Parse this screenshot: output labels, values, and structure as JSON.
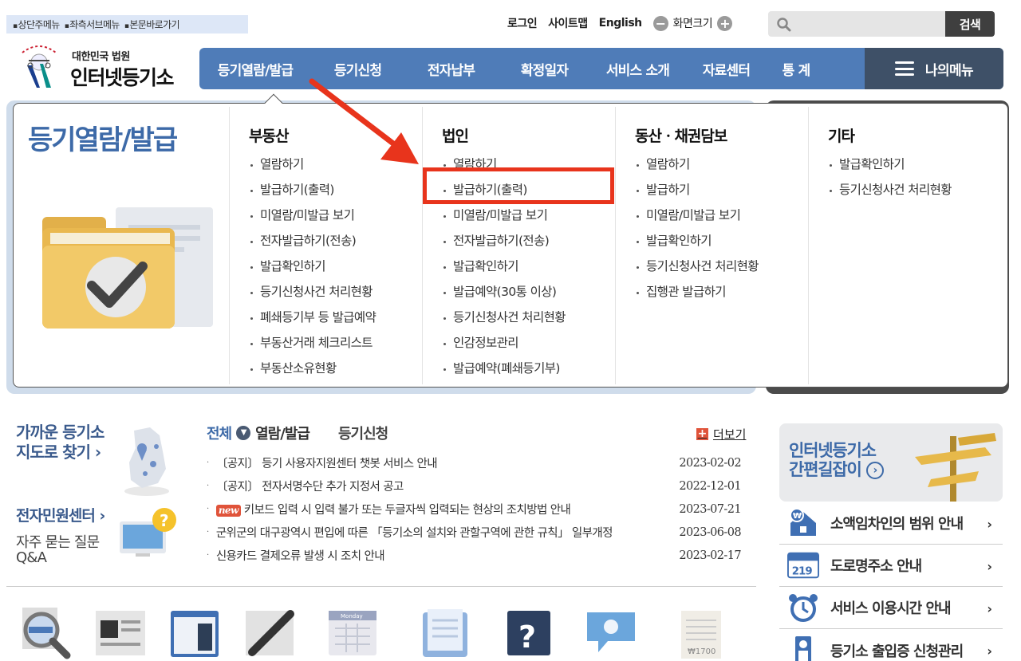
{
  "skip_links": [
    "상단주메뉴",
    "좌측서브메뉴",
    "본문바로가기"
  ],
  "top_links": {
    "login": "로그인",
    "sitemap": "사이트맵",
    "english": "English",
    "zoom": "화면크기"
  },
  "search": {
    "placeholder": "",
    "button": "검색"
  },
  "logo": {
    "sub": "대한민국 법원",
    "main": "인터넷등기소"
  },
  "gnb": {
    "items": [
      "등기열람/발급",
      "등기신청",
      "전자납부",
      "확정일자",
      "서비스 소개",
      "자료센터",
      "통 계"
    ],
    "my_menu": "나의메뉴"
  },
  "dropdown": {
    "title": "등기열람/발급",
    "columns": [
      {
        "heading": "부동산",
        "items": [
          "열람하기",
          "발급하기(출력)",
          "미열람/미발급 보기",
          "전자발급하기(전송)",
          "발급확인하기",
          "등기신청사건 처리현황",
          "폐쇄등기부 등 발급예약",
          "부동산거래 체크리스트",
          "부동산소유현황"
        ]
      },
      {
        "heading": "법인",
        "items": [
          "열람하기",
          "발급하기(출력)",
          "미열람/미발급 보기",
          "전자발급하기(전송)",
          "발급확인하기",
          "발급예약(30통 이상)",
          "등기신청사건 처리현황",
          "인감정보관리",
          "발급예약(폐쇄등기부)"
        ]
      },
      {
        "heading": "동산ㆍ채권담보",
        "items": [
          "열람하기",
          "발급하기",
          "미열람/미발급 보기",
          "발급확인하기",
          "등기신청사건 처리현황",
          "집행관 발급하기"
        ]
      },
      {
        "heading": "기타",
        "items": [
          "발급확인하기",
          "등기신청사건 처리현황"
        ]
      }
    ]
  },
  "left": {
    "nearby_line1": "가까운 등기소",
    "nearby_line2": "지도로 찾기 ›",
    "civil_title": "전자민원센터 ›",
    "civil_sub1": "자주 묻는 질문",
    "civil_sub2": "Q&A"
  },
  "notice_tabs": {
    "all": "전체",
    "view": "열람/발급",
    "apply": "등기신청"
  },
  "more": "더보기",
  "notices": [
    {
      "badge": "",
      "text": "〔공지〕 등기 사용자지원센터 챗봇 서비스 안내",
      "date": "2023-02-02"
    },
    {
      "badge": "",
      "text": "〔공지〕 전자서명수단 추가 지정서 공고",
      "date": "2022-12-01"
    },
    {
      "badge": "new",
      "text": "키보드 입력 시 입력 불가 또는 두글자씩 입력되는 현상의 조치방법 안내",
      "date": "2023-07-21"
    },
    {
      "badge": "",
      "text": "군위군의 대구광역시 편입에 따른 「등기소의 설치와 관할구역에 관한 규칙」 일부개정",
      "date": "2023-06-08"
    },
    {
      "badge": "",
      "text": "신용카드 결제오류 발생 시 조치 안내",
      "date": "2023-02-17"
    }
  ],
  "guide": {
    "line1": "인터넷등기소",
    "line2": "간편길잡이"
  },
  "right_links": [
    "소액임차인의 범위 안내",
    "도로명주소 안내",
    "서비스 이용시간 안내",
    "등기소 출입증 신청관리"
  ],
  "illustration_text": {
    "calendar": "Monday",
    "receipt": "₩1700",
    "road_sign": "219"
  }
}
